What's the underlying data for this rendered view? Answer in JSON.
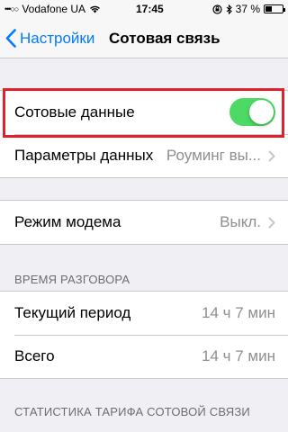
{
  "statusbar": {
    "signal_dots": "•••○○",
    "carrier": "Vodafone UA",
    "time": "17:45",
    "battery_percent": "37 %",
    "battery_level": 0.37
  },
  "navbar": {
    "back_label": "Настройки",
    "title": "Сотовая связь"
  },
  "cellular": {
    "data_label": "Сотовые данные",
    "data_enabled": true,
    "options_label": "Параметры данных",
    "options_value": "Роуминг вы..."
  },
  "hotspot": {
    "label": "Режим модема",
    "value": "Выкл."
  },
  "call_time": {
    "header": "ВРЕМЯ РАЗГОВОРА",
    "current_label": "Текущий период",
    "current_value": "14 ч 7 мин",
    "total_label": "Всего",
    "total_value": "14 ч 7 мин"
  },
  "tariff": {
    "header": "СТАТИСТИКА ТАРИФА СОТОВОЙ СВЯЗИ"
  },
  "colors": {
    "accent": "#007aff",
    "toggle_on": "#4cd964",
    "highlight": "#e0202c"
  }
}
